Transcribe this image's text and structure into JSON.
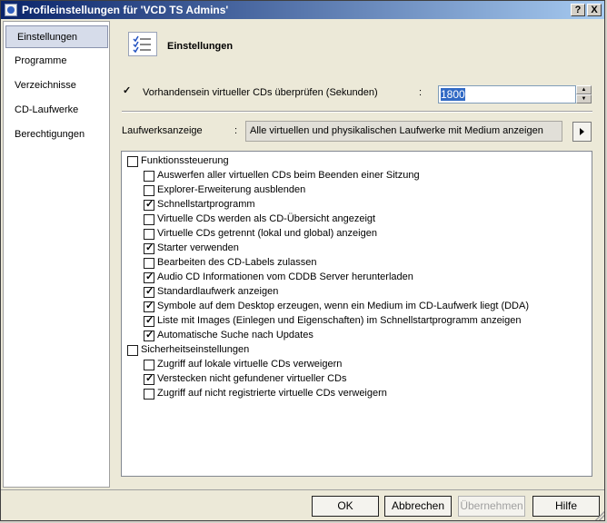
{
  "window": {
    "title": "Profileinstellungen für 'VCD TS Admins'",
    "help_glyph": "?",
    "close_glyph": "X"
  },
  "sidebar": {
    "items": [
      {
        "label": "Einstellungen",
        "selected": true
      },
      {
        "label": "Programme"
      },
      {
        "label": "Verzeichnisse"
      },
      {
        "label": "CD-Laufwerke"
      },
      {
        "label": "Berechtigungen"
      }
    ]
  },
  "header": {
    "title": "Einstellungen",
    "icon": "checklist-icon"
  },
  "check_virtual": {
    "label": "Vorhandensein virtueller CDs überprüfen (Sekunden)",
    "separator": ":",
    "checked": true,
    "value": "1800"
  },
  "drive_display": {
    "label": "Laufwerksanzeige",
    "separator": ":",
    "value": "Alle virtuellen und physikalischen Laufwerke mit Medium anzeigen"
  },
  "settings": {
    "groups": [
      {
        "label": "Funktionssteuerung",
        "checked": false,
        "items": [
          {
            "label": "Auswerfen aller virtuellen CDs beim Beenden einer Sitzung",
            "checked": false
          },
          {
            "label": "Explorer-Erweiterung ausblenden",
            "checked": false
          },
          {
            "label": "Schnellstartprogramm",
            "checked": true
          },
          {
            "label": "Virtuelle CDs werden als CD-Übersicht angezeigt",
            "checked": false
          },
          {
            "label": "Virtuelle CDs getrennt (lokal und global) anzeigen",
            "checked": false
          },
          {
            "label": "Starter verwenden",
            "checked": true
          },
          {
            "label": "Bearbeiten des CD-Labels zulassen",
            "checked": false
          },
          {
            "label": "Audio CD Informationen vom CDDB Server herunterladen",
            "checked": true
          },
          {
            "label": "Standardlaufwerk anzeigen",
            "checked": true
          },
          {
            "label": "Symbole auf dem Desktop erzeugen, wenn ein Medium im CD-Laufwerk liegt (DDA)",
            "checked": true
          },
          {
            "label": "Liste mit Images (Einlegen und Eigenschaften) im Schnellstartprogramm anzeigen",
            "checked": true
          },
          {
            "label": "Automatische Suche nach Updates",
            "checked": true
          }
        ]
      },
      {
        "label": "Sicherheitseinstellungen",
        "checked": false,
        "items": [
          {
            "label": "Zugriff auf lokale virtuelle CDs verweigern",
            "checked": false
          },
          {
            "label": "Verstecken nicht gefundener virtueller CDs",
            "checked": true
          },
          {
            "label": "Zugriff auf nicht registrierte virtuelle CDs verweigern",
            "checked": false
          }
        ]
      }
    ]
  },
  "buttons": {
    "ok": "OK",
    "cancel": "Abbrechen",
    "apply": "Übernehmen",
    "help": "Hilfe"
  }
}
